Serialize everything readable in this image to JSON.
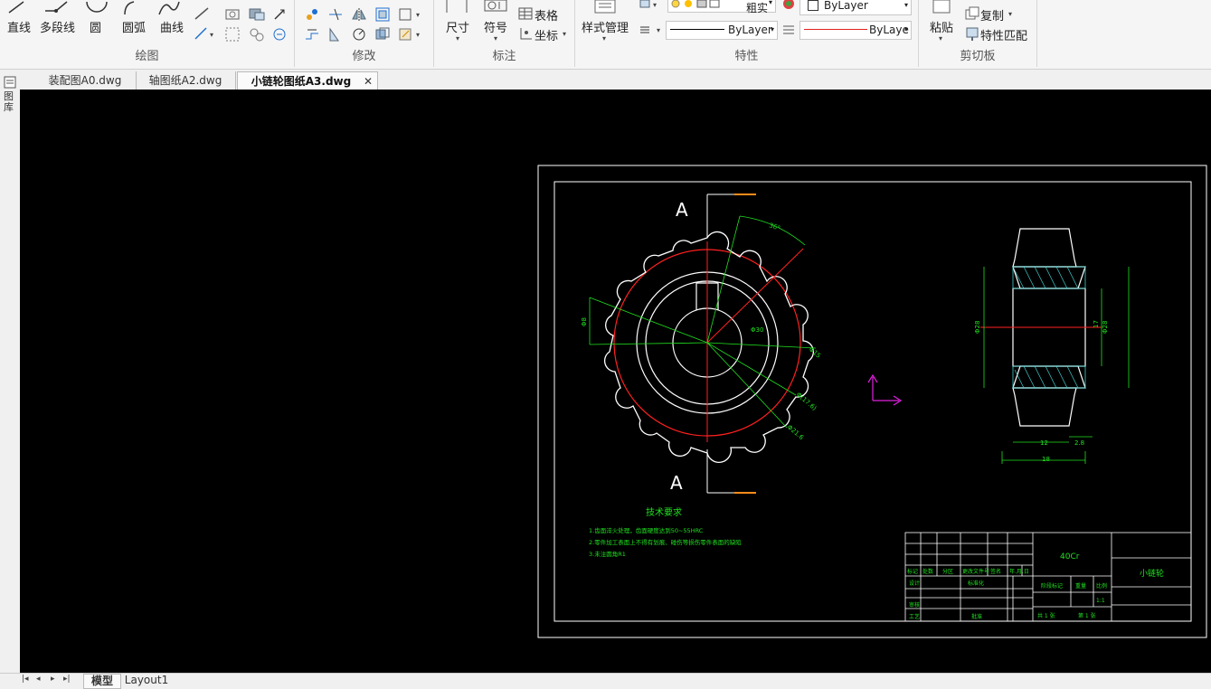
{
  "ribbon": {
    "draw": {
      "title": "绘图",
      "line": "直线",
      "polyline": "多段线",
      "circle": "圆",
      "arc": "圆弧",
      "curve": "曲线"
    },
    "modify": {
      "title": "修改"
    },
    "annotate": {
      "title": "标注",
      "dimension": "尺寸",
      "symbol": "符号",
      "table": "表格",
      "coordinate": "坐标"
    },
    "properties": {
      "title": "特性",
      "style_manager": "样式管理",
      "layer_name": "粗实",
      "color": "ByLayer",
      "linetype": "ByLayer",
      "lineweight": "ByLaye"
    },
    "clipboard": {
      "title": "剪切板",
      "paste": "粘贴",
      "copy": "复制",
      "match": "特性匹配"
    }
  },
  "tabs": [
    {
      "label": "装配图A0.dwg"
    },
    {
      "label": "轴图纸A2.dwg"
    },
    {
      "label": "小链轮图纸A3.dwg"
    }
  ],
  "sidebar_label": "图库",
  "layout_tabs": {
    "model": "模型",
    "layout1": "Layout1"
  },
  "drawing": {
    "section_label": "A",
    "tech_title": "技术要求",
    "tech_lines": [
      "1.齿面淬火处理，齿面硬度达到50~55HRC",
      "2.零件加工表面上不得有划痕、碰伤等损伤零件表面的缺陷",
      "3.未注圆角R1"
    ],
    "material": "40Cr",
    "part_name": "小链轮",
    "dims": {
      "angle": "36°",
      "d1": "Φ8",
      "d2": "Φ15",
      "d3": "Φ(17.6)",
      "d4": "Φ21.6",
      "hub": "Φ30",
      "w1": "12",
      "w2": "2.8",
      "w3": "18",
      "h1": "Φ28",
      "h2": "17",
      "h3": "Φ28"
    },
    "title_block": {
      "r1": "标记",
      "r2": "处数",
      "r3": "分区",
      "r4": "更改文件号",
      "r5": "签名",
      "r6": "年.月.日",
      "design": "设计",
      "std": "标准化",
      "review": "审核",
      "process": "工艺",
      "approve": "批准",
      "stage": "阶段标记",
      "weight": "重量",
      "scale": "比例",
      "scale_val": "1:1",
      "sheets": "共 1 张",
      "sheet": "第 1 张"
    },
    "colors": {
      "white": "#ffffff",
      "red": "#ff2020",
      "green": "#20e020",
      "magenta": "#e020e0",
      "orange": "#ff8c1a",
      "cyan": "#40d0d0"
    }
  }
}
